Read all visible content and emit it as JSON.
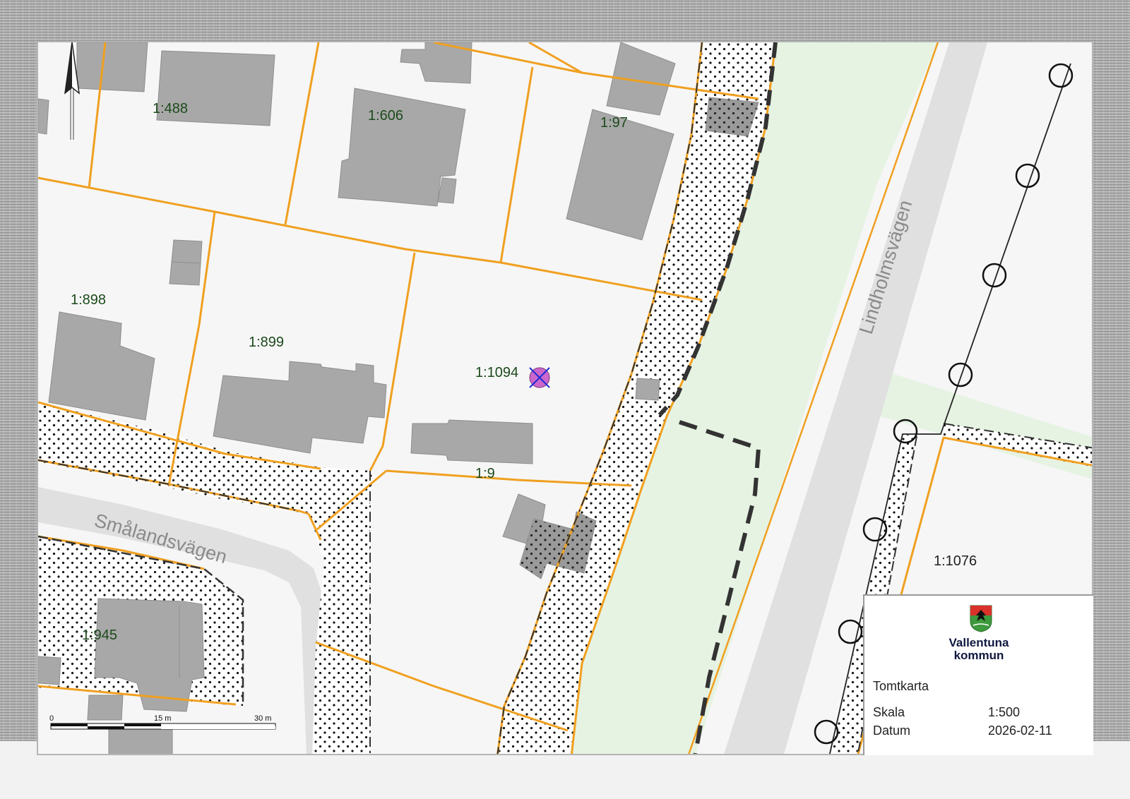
{
  "map": {
    "parcels": {
      "p488": "1:488",
      "p606": "1:606",
      "p97": "1:97",
      "p898": "1:898",
      "p899": "1:899",
      "p1094": "1:1094",
      "p9": "1:9",
      "p945": "1:945",
      "p1076": "1:1076"
    },
    "roads": {
      "smalandsvagen": "Smålandsvägen",
      "lindholmsvagen": "Lindholmsvägen"
    },
    "scale_bar": {
      "zero": "0",
      "mid": "15 m",
      "end": "30 m"
    },
    "icons": [
      "north-arrow-icon",
      "selected-point-marker-icon",
      "municipality-coat-of-arms-icon"
    ]
  },
  "legend": {
    "organization_line1": "Vallentuna",
    "organization_line2": "kommun",
    "document_title": "Tomtkarta",
    "scale_label": "Skala",
    "scale_value": "1:500",
    "date_label": "Datum",
    "date_value": "2026-02-11"
  },
  "colors": {
    "parcel_line": "#f0a020",
    "building": "#a8a8a8",
    "road_surface": "#e0e0e0",
    "green_area": "#e6f3e3",
    "marker": "#cc66cc"
  }
}
